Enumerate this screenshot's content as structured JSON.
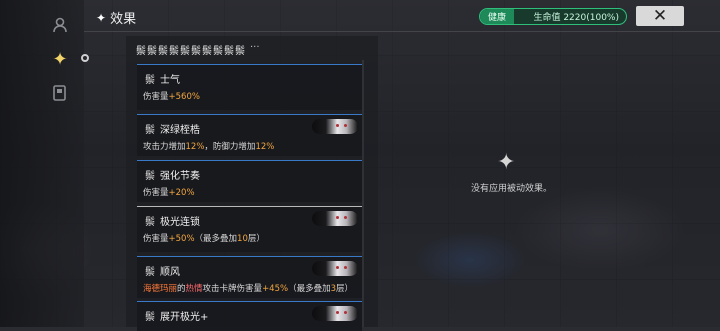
{
  "header": {
    "title": "效果",
    "title_icon": "sparkle-icon",
    "status_label": "健康",
    "hp_text": "生命值 2220(100%)",
    "close_icon": "close-x-icon"
  },
  "rail": {
    "items": [
      {
        "icon": "character-icon",
        "active": false
      },
      {
        "icon": "sparkle-icon",
        "active": true
      },
      {
        "icon": "card-icon",
        "active": false
      }
    ]
  },
  "effects_summary": {
    "icons": [
      "鬃",
      "鬃",
      "鬃",
      "鬃",
      "鬃",
      "鬃",
      "鬃",
      "鬃",
      "鬃",
      "鬃"
    ],
    "more": "···"
  },
  "effects": [
    {
      "title": "士气",
      "desc_parts": [
        {
          "t": "伤害量"
        },
        {
          "t": "+560%",
          "c": "o"
        }
      ],
      "portrait": false
    },
    {
      "title": "深绿桎梏",
      "desc_parts": [
        {
          "t": "攻击力增加"
        },
        {
          "t": "12%",
          "c": "o"
        },
        {
          "t": "，防御力增加"
        },
        {
          "t": "12%",
          "c": "o"
        }
      ],
      "portrait": true
    },
    {
      "title": "强化节奏",
      "desc_parts": [
        {
          "t": "伤害量"
        },
        {
          "t": "+20%",
          "c": "o"
        }
      ],
      "portrait": false
    },
    {
      "title": "极光连锁",
      "desc_parts": [
        {
          "t": "伤害量"
        },
        {
          "t": "+50%",
          "c": "o"
        },
        {
          "t": "（最多叠加"
        },
        {
          "t": "10",
          "c": "o"
        },
        {
          "t": "层）"
        }
      ],
      "portrait": true
    },
    {
      "title": "顺风",
      "desc_parts": [
        {
          "t": "海德玛丽",
          "c": "r"
        },
        {
          "t": "的"
        },
        {
          "t": "热情",
          "c": "p"
        },
        {
          "t": "攻击卡牌伤害量"
        },
        {
          "t": "+45%",
          "c": "o"
        },
        {
          "t": "（最多叠加"
        },
        {
          "t": "3",
          "c": "o"
        },
        {
          "t": "层）"
        }
      ],
      "portrait": true
    },
    {
      "title": "展开极光+",
      "desc_parts": [],
      "portrait": true
    }
  ],
  "passive": {
    "icon": "sparkle-icon",
    "empty_text": "没有应用被动效果。"
  },
  "colors": {
    "accent_blue": "#3a78c8",
    "highlight_orange": "#f2a640",
    "health_green": "#1e8a5a"
  }
}
